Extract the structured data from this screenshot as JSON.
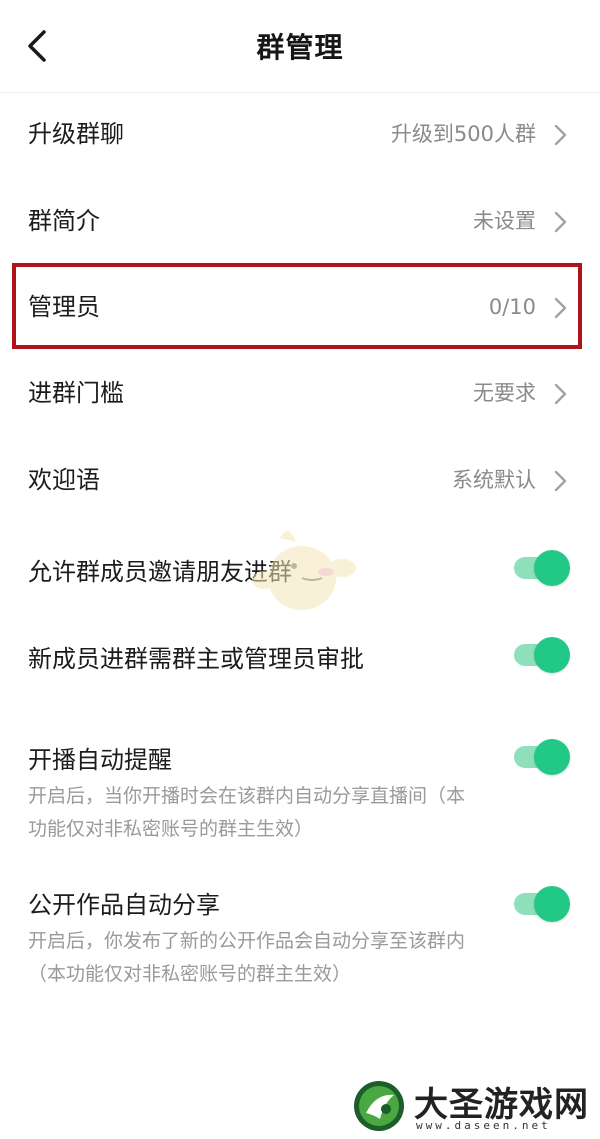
{
  "header": {
    "title": "群管理",
    "back_icon": "chevron-left-icon"
  },
  "rows": [
    {
      "label": "升级群聊",
      "value": "升级到500人群"
    },
    {
      "label": "群简介",
      "value": "未设置"
    },
    {
      "label": "管理员",
      "value": "0/10",
      "highlighted": true
    },
    {
      "label": "进群门槛",
      "value": "无要求"
    },
    {
      "label": "欢迎语",
      "value": "系统默认"
    }
  ],
  "toggles": [
    {
      "label": "允许群成员邀请朋友进群",
      "on": true
    },
    {
      "label": "新成员进群需群主或管理员审批",
      "on": true
    },
    {
      "label": "开播自动提醒",
      "description": "开启后，当你开播时会在该群内自动分享直播间（本功能仅对非私密账号的群主生效）",
      "on": true
    },
    {
      "label": "公开作品自动分享",
      "description": "开启后，你发布了新的公开作品会自动分享至该群内（本功能仅对非私密账号的群主生效）",
      "on": true
    }
  ],
  "colors": {
    "toggle_on": "#22c886",
    "toggle_track": "#8ee0bc",
    "highlight_border": "#b01418"
  },
  "watermark": {
    "name": "大圣游戏网",
    "url": "www.daseen.net"
  }
}
